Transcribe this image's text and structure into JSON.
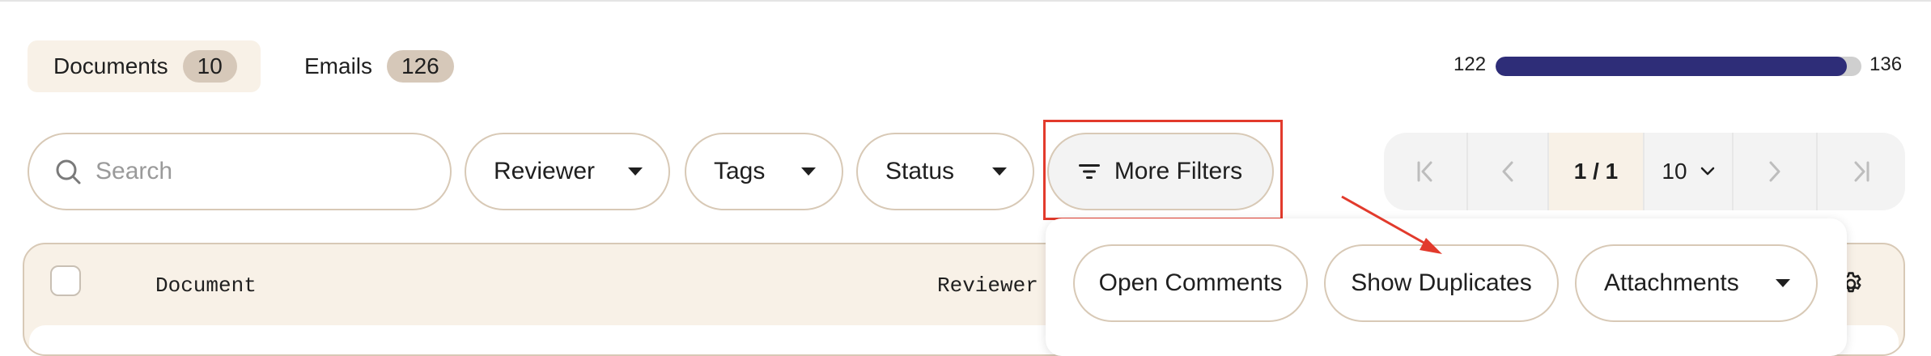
{
  "tabs": [
    {
      "label": "Documents",
      "count": "10"
    },
    {
      "label": "Emails",
      "count": "126"
    }
  ],
  "progress": {
    "left": "122",
    "right": "136",
    "fraction": 0.96
  },
  "search": {
    "placeholder": "Search"
  },
  "filters": {
    "reviewer": "Reviewer",
    "tags": "Tags",
    "status": "Status",
    "more": "More Filters"
  },
  "pagination": {
    "current": "1 / 1",
    "page_size": "10"
  },
  "table": {
    "columns": [
      "Document",
      "Reviewer"
    ]
  },
  "popover": {
    "open_comments": "Open Comments",
    "show_duplicates": "Show Duplicates",
    "attachments": "Attachments"
  },
  "colors": {
    "accent": "#2e2d78",
    "highlight": "#e23a2c",
    "tab_bg": "#f8f1e7",
    "badge": "#d6c8b9"
  }
}
